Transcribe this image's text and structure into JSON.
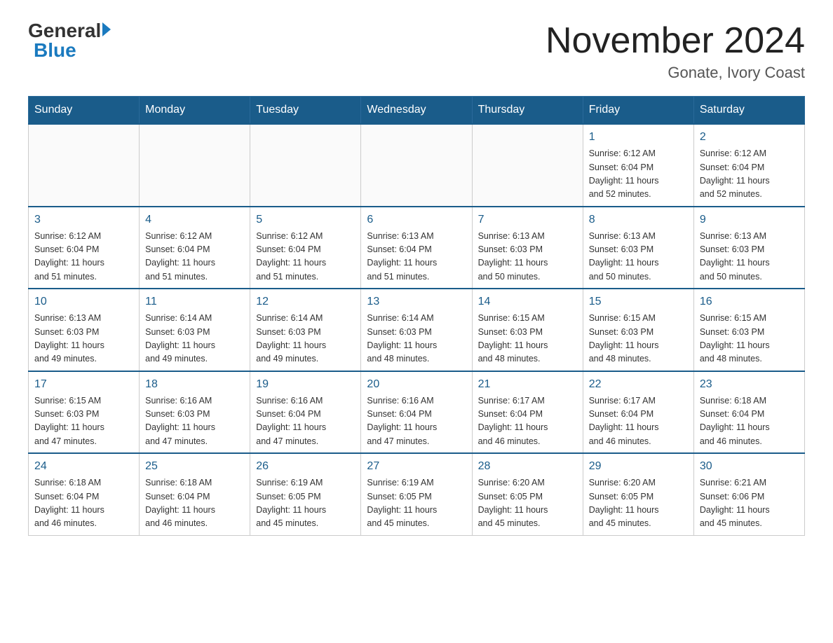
{
  "header": {
    "logo_general": "General",
    "logo_blue": "Blue",
    "month_title": "November 2024",
    "location": "Gonate, Ivory Coast"
  },
  "weekdays": [
    "Sunday",
    "Monday",
    "Tuesday",
    "Wednesday",
    "Thursday",
    "Friday",
    "Saturday"
  ],
  "weeks": [
    [
      {
        "day": "",
        "info": ""
      },
      {
        "day": "",
        "info": ""
      },
      {
        "day": "",
        "info": ""
      },
      {
        "day": "",
        "info": ""
      },
      {
        "day": "",
        "info": ""
      },
      {
        "day": "1",
        "info": "Sunrise: 6:12 AM\nSunset: 6:04 PM\nDaylight: 11 hours\nand 52 minutes."
      },
      {
        "day": "2",
        "info": "Sunrise: 6:12 AM\nSunset: 6:04 PM\nDaylight: 11 hours\nand 52 minutes."
      }
    ],
    [
      {
        "day": "3",
        "info": "Sunrise: 6:12 AM\nSunset: 6:04 PM\nDaylight: 11 hours\nand 51 minutes."
      },
      {
        "day": "4",
        "info": "Sunrise: 6:12 AM\nSunset: 6:04 PM\nDaylight: 11 hours\nand 51 minutes."
      },
      {
        "day": "5",
        "info": "Sunrise: 6:12 AM\nSunset: 6:04 PM\nDaylight: 11 hours\nand 51 minutes."
      },
      {
        "day": "6",
        "info": "Sunrise: 6:13 AM\nSunset: 6:04 PM\nDaylight: 11 hours\nand 51 minutes."
      },
      {
        "day": "7",
        "info": "Sunrise: 6:13 AM\nSunset: 6:03 PM\nDaylight: 11 hours\nand 50 minutes."
      },
      {
        "day": "8",
        "info": "Sunrise: 6:13 AM\nSunset: 6:03 PM\nDaylight: 11 hours\nand 50 minutes."
      },
      {
        "day": "9",
        "info": "Sunrise: 6:13 AM\nSunset: 6:03 PM\nDaylight: 11 hours\nand 50 minutes."
      }
    ],
    [
      {
        "day": "10",
        "info": "Sunrise: 6:13 AM\nSunset: 6:03 PM\nDaylight: 11 hours\nand 49 minutes."
      },
      {
        "day": "11",
        "info": "Sunrise: 6:14 AM\nSunset: 6:03 PM\nDaylight: 11 hours\nand 49 minutes."
      },
      {
        "day": "12",
        "info": "Sunrise: 6:14 AM\nSunset: 6:03 PM\nDaylight: 11 hours\nand 49 minutes."
      },
      {
        "day": "13",
        "info": "Sunrise: 6:14 AM\nSunset: 6:03 PM\nDaylight: 11 hours\nand 48 minutes."
      },
      {
        "day": "14",
        "info": "Sunrise: 6:15 AM\nSunset: 6:03 PM\nDaylight: 11 hours\nand 48 minutes."
      },
      {
        "day": "15",
        "info": "Sunrise: 6:15 AM\nSunset: 6:03 PM\nDaylight: 11 hours\nand 48 minutes."
      },
      {
        "day": "16",
        "info": "Sunrise: 6:15 AM\nSunset: 6:03 PM\nDaylight: 11 hours\nand 48 minutes."
      }
    ],
    [
      {
        "day": "17",
        "info": "Sunrise: 6:15 AM\nSunset: 6:03 PM\nDaylight: 11 hours\nand 47 minutes."
      },
      {
        "day": "18",
        "info": "Sunrise: 6:16 AM\nSunset: 6:03 PM\nDaylight: 11 hours\nand 47 minutes."
      },
      {
        "day": "19",
        "info": "Sunrise: 6:16 AM\nSunset: 6:04 PM\nDaylight: 11 hours\nand 47 minutes."
      },
      {
        "day": "20",
        "info": "Sunrise: 6:16 AM\nSunset: 6:04 PM\nDaylight: 11 hours\nand 47 minutes."
      },
      {
        "day": "21",
        "info": "Sunrise: 6:17 AM\nSunset: 6:04 PM\nDaylight: 11 hours\nand 46 minutes."
      },
      {
        "day": "22",
        "info": "Sunrise: 6:17 AM\nSunset: 6:04 PM\nDaylight: 11 hours\nand 46 minutes."
      },
      {
        "day": "23",
        "info": "Sunrise: 6:18 AM\nSunset: 6:04 PM\nDaylight: 11 hours\nand 46 minutes."
      }
    ],
    [
      {
        "day": "24",
        "info": "Sunrise: 6:18 AM\nSunset: 6:04 PM\nDaylight: 11 hours\nand 46 minutes."
      },
      {
        "day": "25",
        "info": "Sunrise: 6:18 AM\nSunset: 6:04 PM\nDaylight: 11 hours\nand 46 minutes."
      },
      {
        "day": "26",
        "info": "Sunrise: 6:19 AM\nSunset: 6:05 PM\nDaylight: 11 hours\nand 45 minutes."
      },
      {
        "day": "27",
        "info": "Sunrise: 6:19 AM\nSunset: 6:05 PM\nDaylight: 11 hours\nand 45 minutes."
      },
      {
        "day": "28",
        "info": "Sunrise: 6:20 AM\nSunset: 6:05 PM\nDaylight: 11 hours\nand 45 minutes."
      },
      {
        "day": "29",
        "info": "Sunrise: 6:20 AM\nSunset: 6:05 PM\nDaylight: 11 hours\nand 45 minutes."
      },
      {
        "day": "30",
        "info": "Sunrise: 6:21 AM\nSunset: 6:06 PM\nDaylight: 11 hours\nand 45 minutes."
      }
    ]
  ]
}
